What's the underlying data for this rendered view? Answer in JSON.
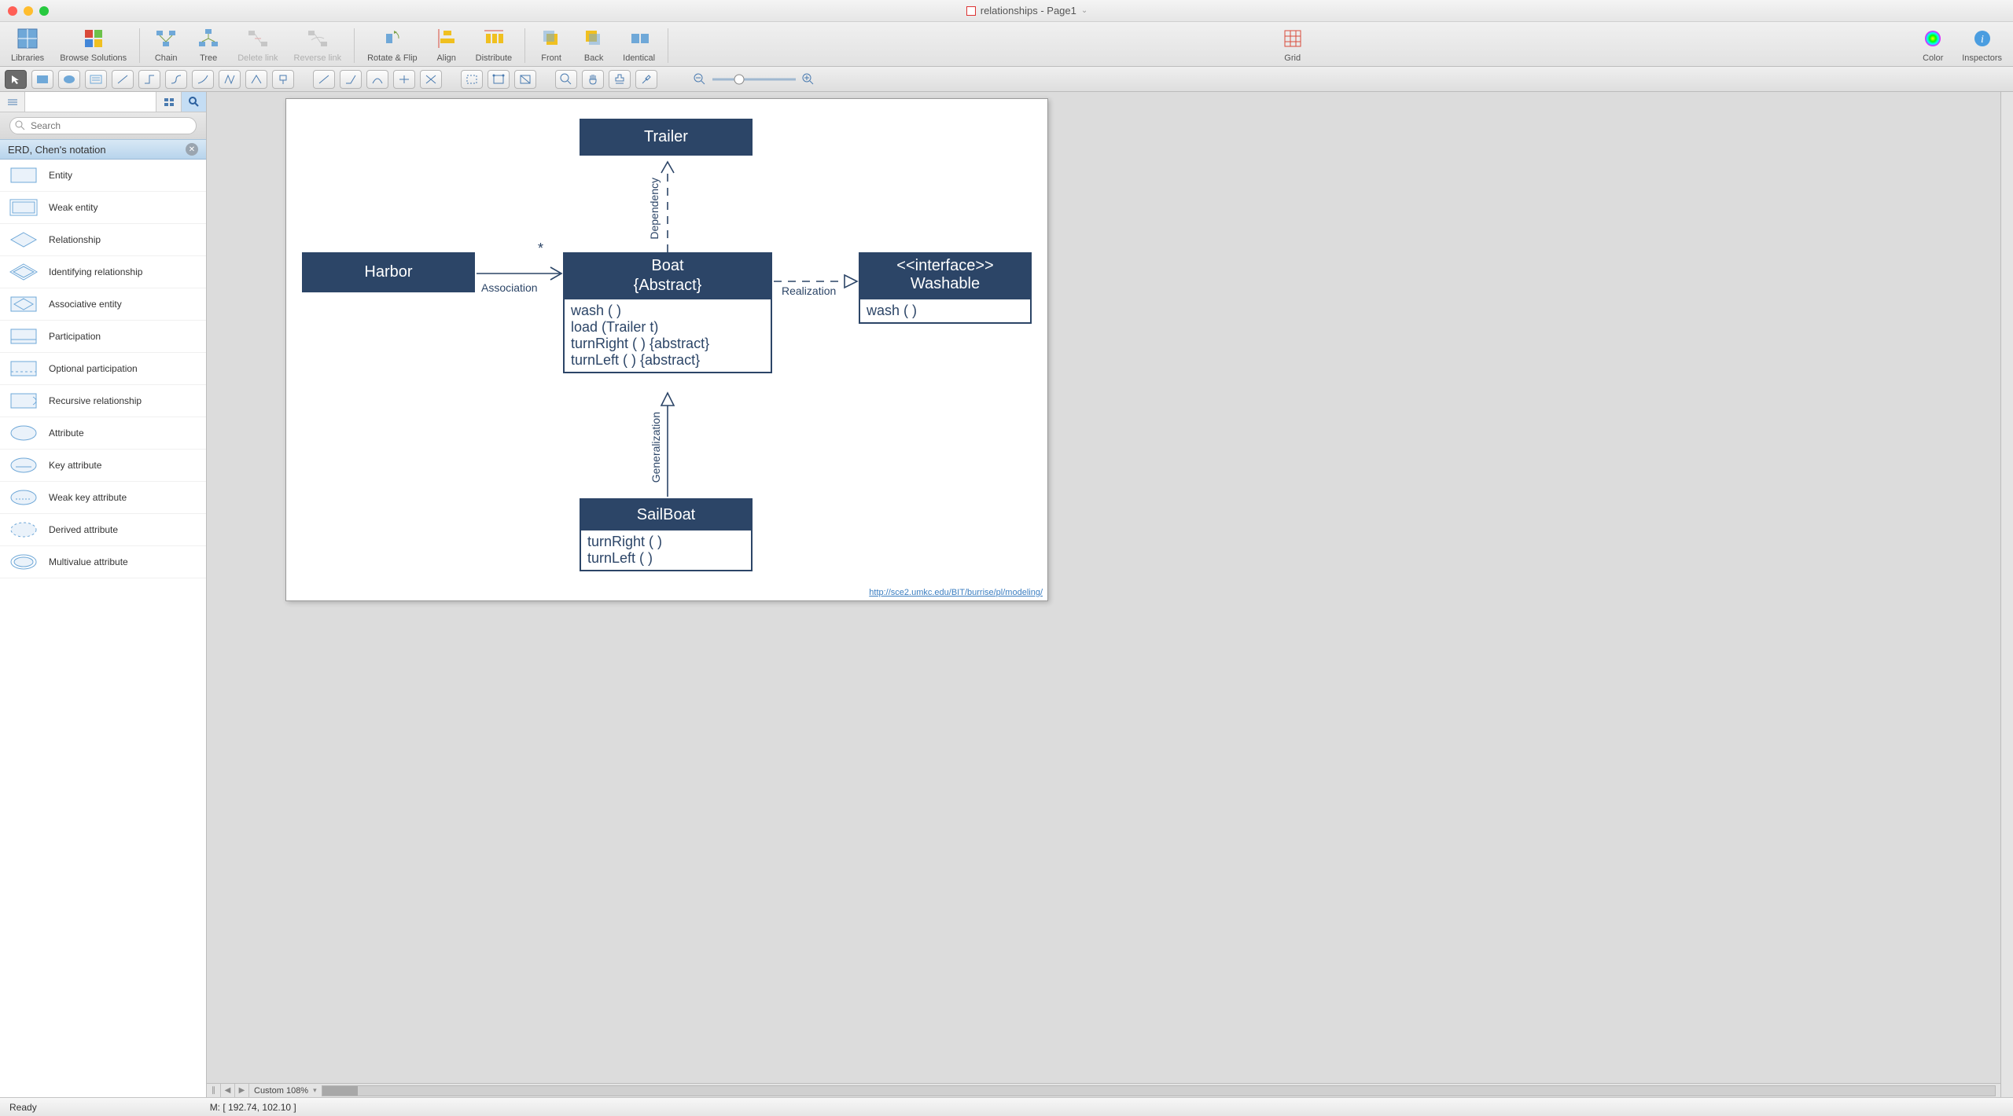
{
  "window": {
    "title": "relationships - Page1"
  },
  "toolbar": {
    "libraries": "Libraries",
    "browse_solutions": "Browse Solutions",
    "chain": "Chain",
    "tree": "Tree",
    "delete_link": "Delete link",
    "reverse_link": "Reverse link",
    "rotate_flip": "Rotate & Flip",
    "align": "Align",
    "distribute": "Distribute",
    "front": "Front",
    "back": "Back",
    "identical": "Identical",
    "grid": "Grid",
    "color": "Color",
    "inspectors": "Inspectors"
  },
  "search": {
    "placeholder": "Search"
  },
  "section": {
    "title": "ERD, Chen's notation"
  },
  "shapes": [
    "Entity",
    "Weak entity",
    "Relationship",
    "Identifying relationship",
    "Associative entity",
    "Participation",
    "Optional participation",
    "Recursive relationship",
    "Attribute",
    "Key attribute",
    "Weak key attribute",
    "Derived attribute",
    "Multivalue attribute"
  ],
  "diagram": {
    "trailer": {
      "title": "Trailer"
    },
    "harbor": {
      "title": "Harbor"
    },
    "boat": {
      "title": "Boat",
      "subtitle": "{Abstract}",
      "ops": [
        "wash ( )",
        "load (Trailer t)",
        "turnRight ( ) {abstract}",
        "turnLeft ( ) {abstract}"
      ]
    },
    "washable": {
      "stereotype": "<<interface>>",
      "title": "Washable",
      "ops": [
        "wash ( )"
      ]
    },
    "sailboat": {
      "title": "SailBoat",
      "ops": [
        "turnRight ( )",
        "turnLeft ( )"
      ]
    },
    "labels": {
      "dependency": "Dependency",
      "association": "Association",
      "star": "*",
      "realization": "Realization",
      "generalization": "Generalization"
    },
    "footer_link": "http://sce2.umkc.edu/BIT/burrise/pl/modeling/"
  },
  "bottom": {
    "zoom": "Custom 108%"
  },
  "status": {
    "ready": "Ready",
    "mouse": "M: [ 192.74, 102.10 ]"
  }
}
